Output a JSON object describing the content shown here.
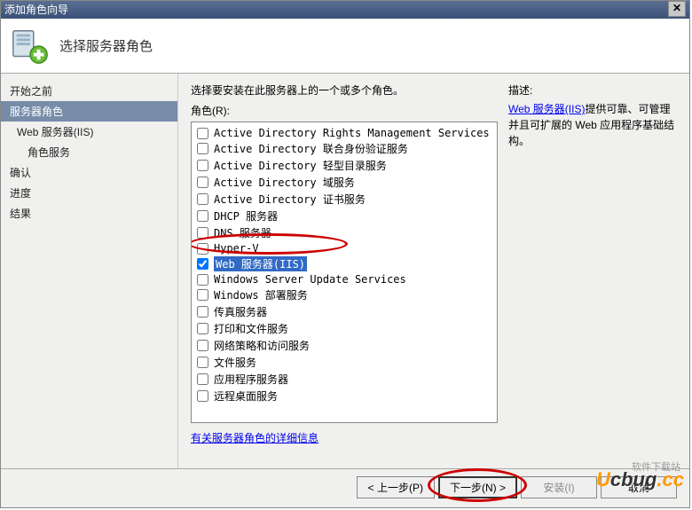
{
  "window": {
    "title": "添加角色向导"
  },
  "header": {
    "title": "选择服务器角色"
  },
  "nav": [
    {
      "label": "开始之前",
      "indent": 0,
      "selected": false
    },
    {
      "label": "服务器角色",
      "indent": 0,
      "selected": true
    },
    {
      "label": "Web 服务器(IIS)",
      "indent": 1,
      "selected": false
    },
    {
      "label": "角色服务",
      "indent": 2,
      "selected": false
    },
    {
      "label": "确认",
      "indent": 0,
      "selected": false
    },
    {
      "label": "进度",
      "indent": 0,
      "selected": false
    },
    {
      "label": "结果",
      "indent": 0,
      "selected": false
    }
  ],
  "main": {
    "instruction": "选择要安装在此服务器上的一个或多个角色。",
    "roles_label": "角色(R):",
    "more_info": "有关服务器角色的详细信息"
  },
  "roles": [
    {
      "name": "Active Directory Rights Management Services",
      "checked": false,
      "selected": false
    },
    {
      "name": "Active Directory 联合身份验证服务",
      "checked": false,
      "selected": false
    },
    {
      "name": "Active Directory 轻型目录服务",
      "checked": false,
      "selected": false
    },
    {
      "name": "Active Directory 域服务",
      "checked": false,
      "selected": false
    },
    {
      "name": "Active Directory 证书服务",
      "checked": false,
      "selected": false
    },
    {
      "name": "DHCP 服务器",
      "checked": false,
      "selected": false
    },
    {
      "name": "DNS 服务器",
      "checked": false,
      "selected": false
    },
    {
      "name": "Hyper-V",
      "checked": false,
      "selected": false
    },
    {
      "name": "Web 服务器(IIS)",
      "checked": true,
      "selected": true
    },
    {
      "name": "Windows Server Update Services",
      "checked": false,
      "selected": false
    },
    {
      "name": "Windows 部署服务",
      "checked": false,
      "selected": false
    },
    {
      "name": "传真服务器",
      "checked": false,
      "selected": false
    },
    {
      "name": "打印和文件服务",
      "checked": false,
      "selected": false
    },
    {
      "name": "网络策略和访问服务",
      "checked": false,
      "selected": false
    },
    {
      "name": "文件服务",
      "checked": false,
      "selected": false
    },
    {
      "name": "应用程序服务器",
      "checked": false,
      "selected": false
    },
    {
      "name": "远程桌面服务",
      "checked": false,
      "selected": false
    }
  ],
  "description": {
    "label": "描述:",
    "link": "Web 服务器(IIS)",
    "text": "提供可靠、可管理并且可扩展的 Web 应用程序基础结构。"
  },
  "buttons": {
    "prev": "< 上一步(P)",
    "next": "下一步(N) >",
    "install": "安装(I)",
    "cancel": "取消"
  },
  "watermark": {
    "sub": "软件下载站",
    "brand": "ucbug.cc"
  }
}
